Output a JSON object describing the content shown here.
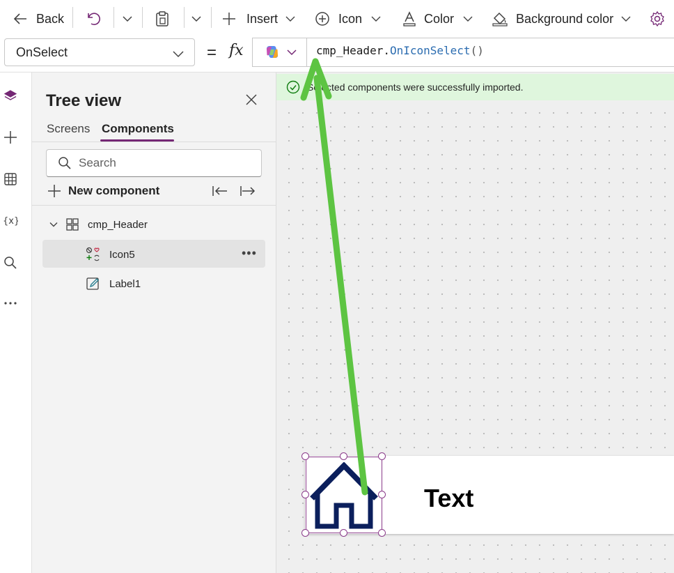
{
  "toolbar": {
    "back_label": "Back",
    "insert_label": "Insert",
    "icon_label": "Icon",
    "color_label": "Color",
    "background_color_label": "Background color"
  },
  "formula_bar": {
    "property": "OnSelect",
    "equals": "=",
    "fx": "fx",
    "formula_object": "cmp_Header",
    "formula_dot": ".",
    "formula_function": "OnIconSelect",
    "formula_parens": "()"
  },
  "tree_view": {
    "title": "Tree view",
    "tabs": [
      "Screens",
      "Components"
    ],
    "active_tab": "Components",
    "search_placeholder": "Search",
    "new_component_label": "New component",
    "nodes": [
      {
        "label": "cmp_Header"
      },
      {
        "label": "Icon5"
      },
      {
        "label": "Label1"
      }
    ]
  },
  "banner": {
    "message": "Selected components were successfully imported."
  },
  "canvas": {
    "header_text": "Text"
  },
  "colors": {
    "accent": "#742774",
    "success_bg": "#dff6dd",
    "success_icon": "#107c10",
    "house_icon": "#0b1f5c",
    "annotation_arrow": "#5dc442"
  }
}
